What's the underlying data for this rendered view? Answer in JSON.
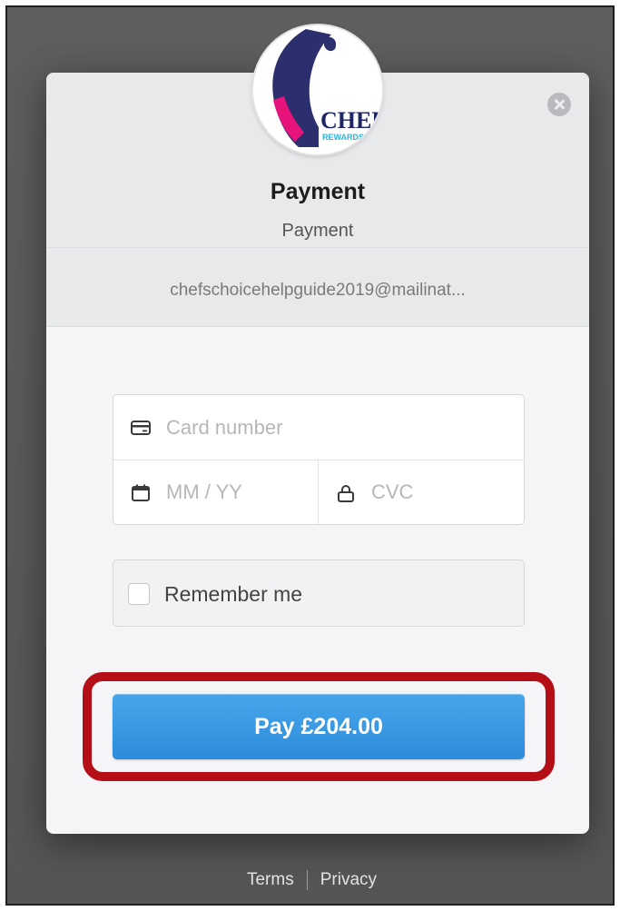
{
  "modal": {
    "title": "Payment",
    "subtitle": "Payment",
    "email": "chefschoicehelpguide2019@mailinat...",
    "logo_text": "CHEF",
    "logo_subtext": "REWARDS"
  },
  "form": {
    "card_number_placeholder": "Card number",
    "expiry_placeholder": "MM / YY",
    "cvc_placeholder": "CVC",
    "remember_label": "Remember me",
    "remember_checked": false,
    "pay_label": "Pay £204.00"
  },
  "icons": {
    "card": "credit-card-icon",
    "calendar": "calendar-icon",
    "lock": "lock-icon",
    "close": "close-icon"
  },
  "footer": {
    "terms": "Terms",
    "privacy": "Privacy"
  },
  "colors": {
    "pay_button": "#3498e0",
    "highlight": "#b40f16",
    "overlay": "#595959"
  }
}
